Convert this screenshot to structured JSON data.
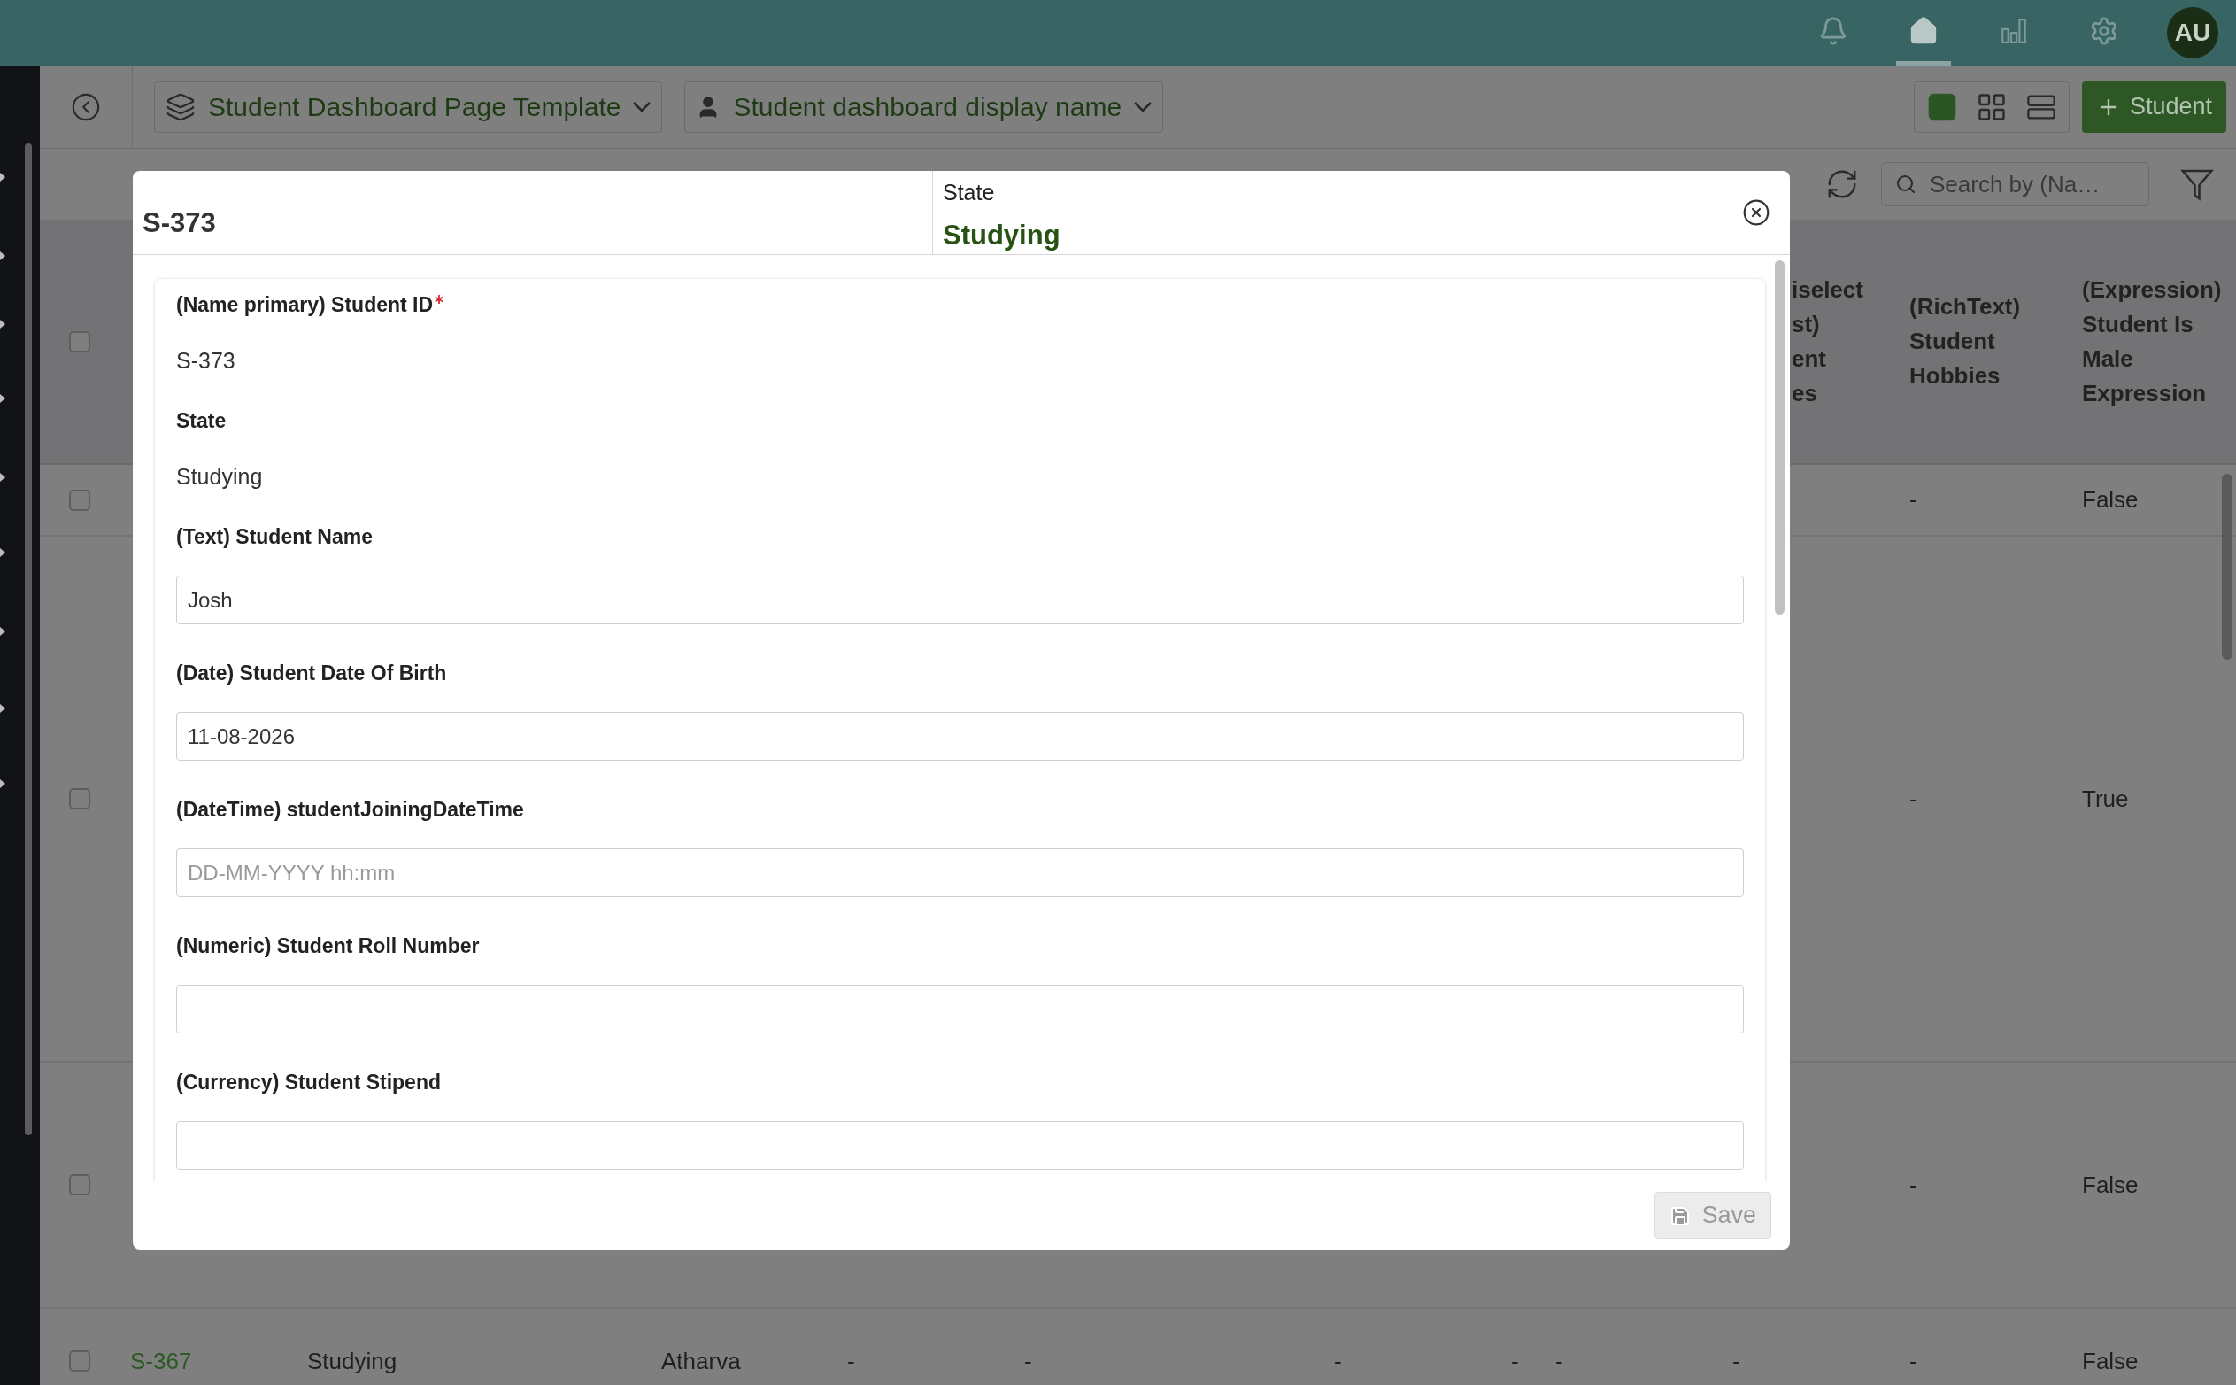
{
  "top_bar": {
    "icons": [
      {
        "kind": "bell",
        "selected": false
      },
      {
        "kind": "home",
        "selected": true
      },
      {
        "kind": "chart",
        "selected": false
      },
      {
        "kind": "settings",
        "selected": false
      }
    ],
    "avatar": "AU"
  },
  "header": {
    "template_dropdown": "Student Dashboard Page Template",
    "display_dropdown": "Student dashboard display name",
    "views": [
      {
        "kind": "tile",
        "selected": true
      },
      {
        "kind": "grid",
        "selected": false
      },
      {
        "kind": "list",
        "selected": false
      }
    ],
    "add_button": "Student"
  },
  "toolbar": {
    "search_placeholder": "Search by (Na…"
  },
  "table": {
    "header_checked": false,
    "headers": {
      "column_10": "iselect\nst)\nent\nes",
      "hobbies": "(RichText) Student Hobbies",
      "is_male": "(Expression) Student Is Male Expression"
    },
    "rows": [
      {
        "checked": false,
        "cells": {
          "hobbies": "-",
          "is_male": "False"
        }
      },
      {
        "checked": false,
        "cells": {
          "hobbies": "-",
          "is_male": "True"
        }
      },
      {
        "checked": false,
        "cells": {
          "hobbies": "-",
          "is_male": "False"
        }
      },
      {
        "checked": false,
        "cells": {
          "id": "S-367",
          "state": "Studying",
          "name": "Atharva",
          "column_5": "-",
          "column_6": "-",
          "column_7": "-",
          "column_8": "-",
          "column_9": "-",
          "column_10": "-",
          "hobbies": "-",
          "is_male": "False"
        }
      }
    ]
  },
  "modal": {
    "title": "S-373",
    "state_label": "State",
    "state_value": "Studying",
    "fields": [
      {
        "kind": "readonly",
        "label": "(Name primary) Student ID",
        "required": true,
        "value": "S-373"
      },
      {
        "kind": "readonly",
        "label": "State",
        "required": false,
        "value": "Studying"
      },
      {
        "kind": "input",
        "label": "(Text) Student Name",
        "required": false,
        "value": "Josh"
      },
      {
        "kind": "input",
        "label": "(Date) Student Date Of Birth",
        "required": false,
        "value": "11-08-2026"
      },
      {
        "kind": "input",
        "label": "(DateTime) studentJoiningDateTime",
        "required": false,
        "placeholder": "DD-MM-YYYY hh:mm"
      },
      {
        "kind": "input",
        "label": "(Numeric) Student Roll Number",
        "required": false
      },
      {
        "kind": "input",
        "label": "(Currency) Student Stipend",
        "required": false
      }
    ],
    "save_button": {
      "label": "Save",
      "disabled": true
    }
  }
}
